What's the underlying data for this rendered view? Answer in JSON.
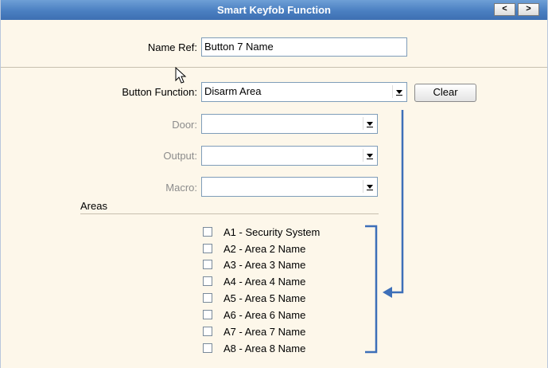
{
  "window": {
    "title": "Smart Keyfob Function",
    "prev_label": "<",
    "next_label": ">"
  },
  "name_ref": {
    "label": "Name Ref:",
    "value": "Button 7 Name"
  },
  "button_function": {
    "label": "Button Function:",
    "selected": "Disarm Area",
    "clear_label": "Clear"
  },
  "door": {
    "label": "Door:",
    "selected": ""
  },
  "output": {
    "label": "Output:",
    "selected": ""
  },
  "macro": {
    "label": "Macro:",
    "selected": ""
  },
  "areas": {
    "title": "Areas",
    "items": [
      {
        "label": "A1 - Security System",
        "checked": false
      },
      {
        "label": "A2 - Area 2 Name",
        "checked": false
      },
      {
        "label": "A3 - Area 3 Name",
        "checked": false
      },
      {
        "label": "A4 - Area 4 Name",
        "checked": false
      },
      {
        "label": "A5 - Area 5 Name",
        "checked": false
      },
      {
        "label": "A6 - Area 6 Name",
        "checked": false
      },
      {
        "label": "A7 - Area 7 Name",
        "checked": false
      },
      {
        "label": "A8 - Area 8 Name",
        "checked": false
      }
    ]
  },
  "colors": {
    "annotation_blue": "#3d6fb8",
    "title_bar": "#4a7fc1",
    "panel_background": "#fdf7ea"
  }
}
